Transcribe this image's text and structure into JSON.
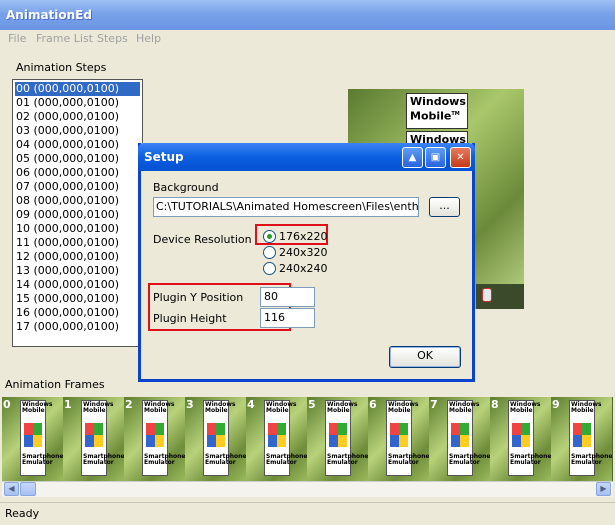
{
  "app": {
    "title": "AnimationEd"
  },
  "menu": [
    "File",
    "Frame List",
    "Steps",
    "Help"
  ],
  "steps": {
    "label": "Animation Steps",
    "items": [
      "00 (000,000,0100)",
      "01 (000,000,0100)",
      "02 (000,000,0100)",
      "03 (000,000,0100)",
      "04 (000,000,0100)",
      "05 (000,000,0100)",
      "06 (000,000,0100)",
      "07 (000,000,0100)",
      "08 (000,000,0100)",
      "09 (000,000,0100)",
      "10 (000,000,0100)",
      "11 (000,000,0100)",
      "12 (000,000,0100)",
      "13 (000,000,0100)",
      "14 (000,000,0100)",
      "15 (000,000,0100)",
      "16 (000,000,0100)",
      "17 (000,000,0100)"
    ],
    "selected_index": 0
  },
  "preview": {
    "logo_line1": "Windows",
    "logo_line2": "Mobile",
    "logo_tm": "TM",
    "logo_peek": "Windows"
  },
  "dialog": {
    "title": "Setup",
    "background_label": "Background",
    "background_value": "C:\\TUTORIALS\\Animated Homescreen\\Files\\enthusia",
    "browse_label": "...",
    "resolution_label": "Device Resolution",
    "resolutions": [
      "176x220",
      "240x320",
      "240x240"
    ],
    "selected_resolution": "176x220",
    "plugin_y_label": "Plugin Y Position",
    "plugin_y_value": "80",
    "plugin_height_label": "Plugin Height",
    "plugin_height_value": "116",
    "ok_label": "OK",
    "highlight_color": "#e0101a"
  },
  "frames": {
    "label": "Animation Frames",
    "numbers": [
      "0",
      "1",
      "2",
      "3",
      "4",
      "5",
      "6",
      "7",
      "8",
      "9"
    ],
    "thumb_lines": [
      "Windows",
      "Mobile",
      "Smartphone",
      "Emulator"
    ]
  },
  "status": {
    "text": "Ready"
  }
}
